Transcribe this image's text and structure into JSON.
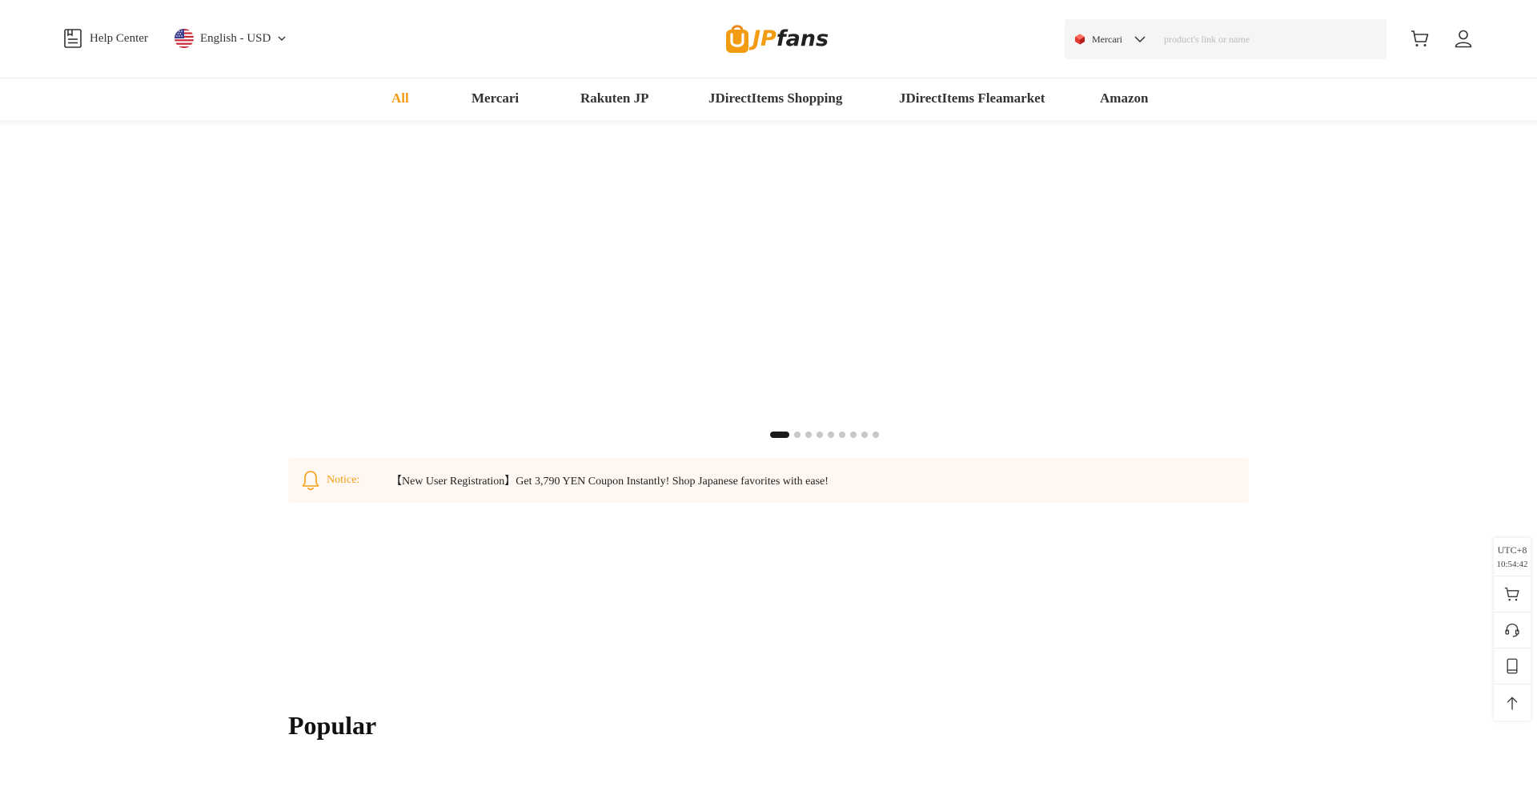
{
  "header": {
    "help_label": "Help Center",
    "lang_label": "English - USD",
    "logo": {
      "prefix": "JP",
      "suffix": "fans"
    },
    "search": {
      "platform": "Mercari",
      "placeholder": "product's link or name"
    }
  },
  "nav": {
    "items": [
      {
        "label": "All"
      },
      {
        "label": "Mercari"
      },
      {
        "label": "Rakuten JP"
      },
      {
        "label": "JDirectItems Shopping"
      },
      {
        "label": "JDirectItems Fleamarket"
      },
      {
        "label": "Amazon"
      }
    ],
    "active_index": 0
  },
  "carousel": {
    "slide_count": 9,
    "active_index": 0
  },
  "notice": {
    "label": "Notice:",
    "text": "【New User Registration】Get 3,790 YEN Coupon Instantly! Shop Japanese favorites with ease!"
  },
  "popular": {
    "title": "Popular"
  },
  "side": {
    "timezone": "UTC+8",
    "time": "10:54:42"
  },
  "colors": {
    "accent": "#f39c12",
    "notice_bg": "#fff8f2",
    "text": "#222222"
  }
}
